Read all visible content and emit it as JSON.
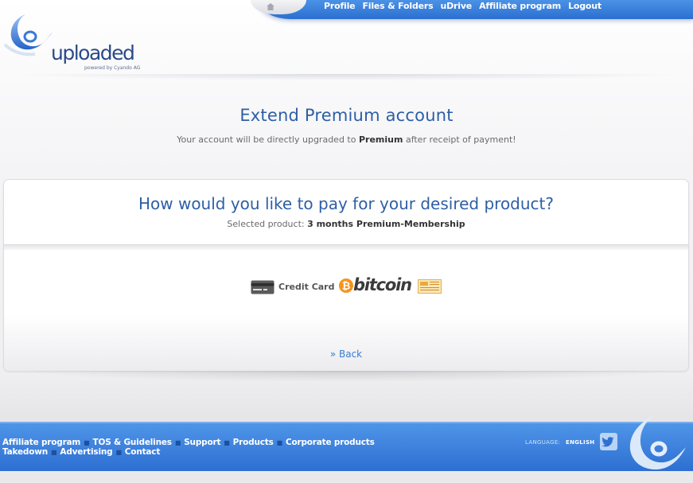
{
  "header": {
    "nav": [
      "Profile",
      "Files & Folders",
      "uDrive",
      "Affiliate program",
      "Logout"
    ],
    "logo_text": "uploaded",
    "logo_sub": "powered by Cyando AG"
  },
  "main": {
    "title": "Extend Premium account",
    "subtitle_pre": "Your account will be directly upgraded to ",
    "subtitle_bold": "Premium",
    "subtitle_post": " after receipt of payment!"
  },
  "panel": {
    "question": "How would you like to pay for your desired product?",
    "selected_label": "Selected product: ",
    "selected_value": "3 months Premium-Membership",
    "payment_methods": {
      "credit_card": "Credit Card",
      "bitcoin": "bitcoin"
    },
    "back_prefix": "» ",
    "back_label": "Back"
  },
  "footer": {
    "row1": [
      "Affiliate program",
      "TOS & Guidelines",
      "Support",
      "Products",
      "Corporate products"
    ],
    "row2": [
      "Takedown",
      "Advertising",
      "Contact"
    ],
    "separator": "■",
    "language_label": "LANGUAGE:",
    "language_value": "ENGLISH"
  },
  "colors": {
    "accent": "#2d5fa6",
    "link": "#3a7bd5",
    "bar_blue": "#2c6fd0",
    "bitcoin_orange": "#f7931a"
  },
  "icons": [
    "home-icon",
    "credit-card-icon",
    "bitcoin-icon",
    "bank-transfer-icon",
    "twitter-icon"
  ]
}
